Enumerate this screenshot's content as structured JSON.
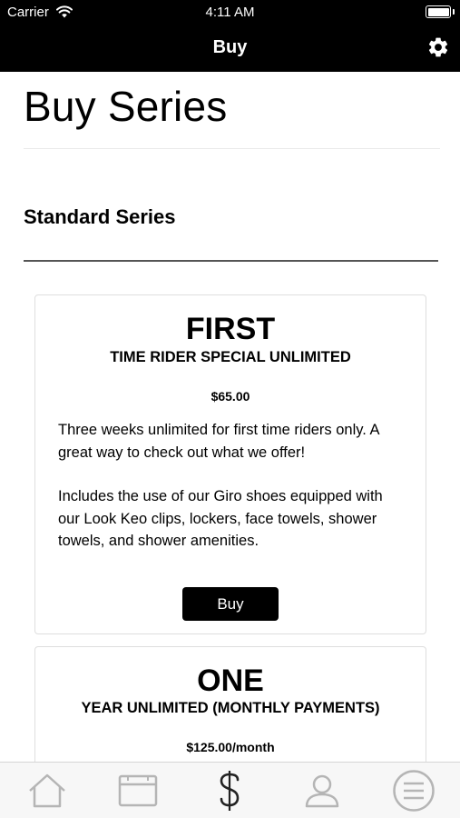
{
  "status_bar": {
    "carrier": "Carrier",
    "time": "4:11 AM",
    "wifi_icon": "wifi-icon",
    "battery_icon": "battery-icon"
  },
  "nav": {
    "title": "Buy",
    "settings_icon": "gear-icon"
  },
  "page": {
    "title": "Buy Series",
    "section_title": "Standard Series"
  },
  "cards": [
    {
      "heading": "FIRST",
      "subheading": "TIME RIDER SPECIAL UNLIMITED",
      "price": "$65.00",
      "description_1": "Three weeks unlimited for first time riders only. A great way to check out what we offer!",
      "description_2": "Includes the use of our Giro shoes equipped with our Look Keo clips, lockers, face towels, shower towels, and shower amenities.",
      "button_label": "Buy"
    },
    {
      "heading": "ONE",
      "subheading": "YEAR UNLIMITED (MONTHLY PAYMENTS)",
      "price": "$125.00/month"
    }
  ],
  "tab_bar": {
    "tabs": [
      {
        "icon": "home-icon",
        "active": false
      },
      {
        "icon": "calendar-icon",
        "active": false
      },
      {
        "icon": "dollar-icon",
        "active": true
      },
      {
        "icon": "profile-icon",
        "active": false
      },
      {
        "icon": "menu-icon",
        "active": false
      }
    ],
    "colors": {
      "active": "#222222",
      "inactive": "#b5b5b5"
    }
  },
  "colors": {
    "nav_background": "#000000",
    "button_background": "#000000",
    "section_divider": "#555555"
  }
}
